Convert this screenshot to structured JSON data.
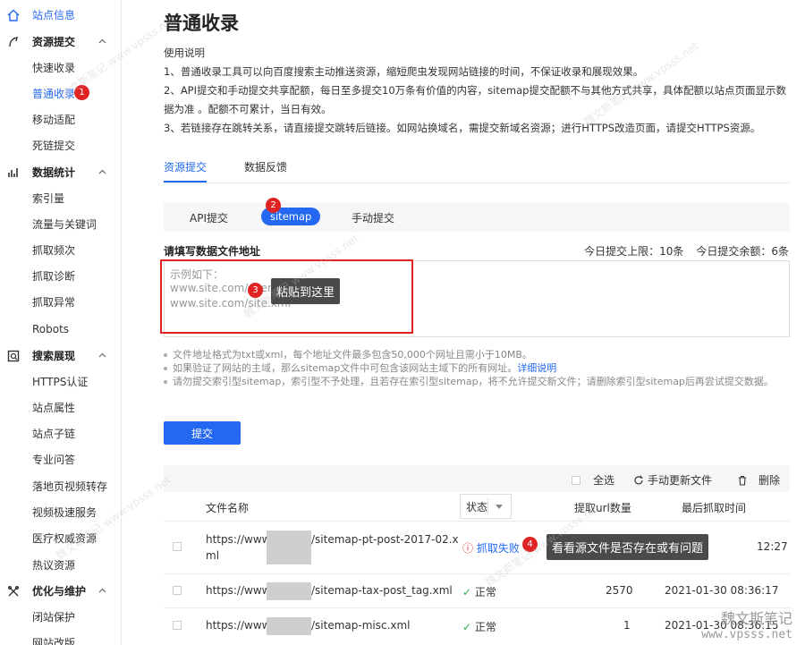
{
  "sidebar": {
    "top": {
      "label": "站点信息"
    },
    "groups": [
      {
        "label": "资源提交",
        "icon": "resource-submit-icon",
        "items": [
          "快速收录",
          "普通收录",
          "移动适配",
          "死链提交"
        ]
      },
      {
        "label": "数据统计",
        "icon": "data-stats-icon",
        "items": [
          "索引量",
          "流量与关键词",
          "抓取频次",
          "抓取诊断",
          "抓取异常",
          "Robots"
        ]
      },
      {
        "label": "搜索展现",
        "icon": "search-display-icon",
        "items": [
          "HTTPS认证",
          "站点属性",
          "站点子链",
          "专业问答",
          "落地页视频转存",
          "视频极速服务",
          "医疗权威资源",
          "热议资源"
        ]
      },
      {
        "label": "优化与维护",
        "icon": "optimize-icon",
        "items": [
          "闭站保护",
          "网站改版"
        ]
      }
    ],
    "active_item": "普通收录"
  },
  "badges": {
    "b1": "1",
    "b2": "2",
    "b3": "3",
    "b4": "4"
  },
  "page": {
    "title": "普通收录",
    "usage_title": "使用说明",
    "usage": [
      "1、普通收录工具可以向百度搜索主动推送资源，缩短爬虫发现网站链接的时间，不保证收录和展现效果。",
      "2、API提交和手动提交共享配额，每日至多提交10万条有价值的内容，sitemap提交配额不与其他方式共享，具体配额以站点页面显示数据为准 。配额不可累计，当日有效。",
      "3、若链接存在跳转关系，请直接提交跳转后链接。如网站换域名，需提交新域名资源；进行HTTPS改造页面，请提交HTTPS资源。"
    ]
  },
  "tabs": {
    "t1": "资源提交",
    "t2": "数据反馈"
  },
  "subtabs": {
    "s1": "API提交",
    "s2": "sitemap",
    "s3": "手动提交"
  },
  "form": {
    "label": "请填写数据文件地址",
    "quota_limit": "今日提交上限：10条",
    "quota_left": "今日提交余额：6条",
    "ph1": "示例如下：",
    "ph2": "www.site.com/sitemap.xml",
    "ph3": "www.site.com/site.xml"
  },
  "tips": {
    "paste": "粘贴到这里",
    "check": "看看源文件是否存在或有问题"
  },
  "notes": {
    "n1": "文件地址格式为txt或xml，每个地址文件最多包含50,000个网址且需小于10MB。",
    "n2": "如果验证了网站的主域，那么sitemap文件中可包含该网站主域下的所有网址。",
    "n2_link": "详细说明",
    "n3": "请勿提交索引型sitemap，索引型不予处理，且若存在索引型sitemap，将不允许提交新文件；请删除索引型sitemap后再尝试提交数据。"
  },
  "submit_label": "提交",
  "table": {
    "select_all": "全选",
    "refresh": "手动更新文件",
    "delete": "删除",
    "headers": {
      "file": "文件名称",
      "status": "状态",
      "urls": "提取url数量",
      "time": "最后抓取时间"
    },
    "rows": [
      {
        "file_a": "https://www.",
        "file_b": "/sitemap-pt-post-2017-02.x",
        "file_c": "ml",
        "status": "抓取失败",
        "count": "",
        "time": "12:27"
      },
      {
        "file_a": "https://www.",
        "file_b": "/sitemap-tax-post_tag.xml",
        "file_c": "",
        "status": "正常",
        "count": "2570",
        "time": "2021-01-30 08:36:17"
      },
      {
        "file_a": "https://www.",
        "file_b": "/sitemap-misc.xml",
        "file_c": "",
        "status": "正常",
        "count": "1",
        "time": "2021-01-30 08:36:15"
      }
    ]
  },
  "watermark": {
    "cn": "魏文斯笔记",
    "en": "www.vpsss.net"
  },
  "colors": {
    "accent": "#2468f2",
    "danger": "#e02424",
    "ok": "#2eab4a"
  }
}
